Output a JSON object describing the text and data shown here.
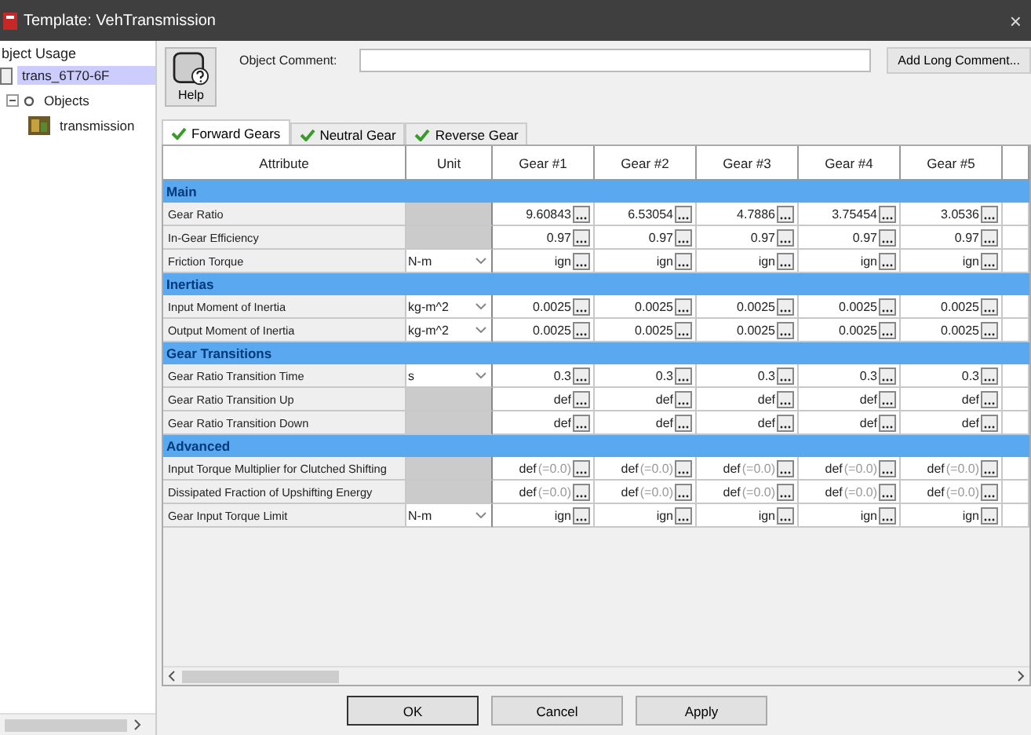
{
  "window": {
    "title": "Template: VehTransmission",
    "close": "×"
  },
  "sidebar": {
    "heading": "bject Usage",
    "items": [
      {
        "label": "trans_6T70-6F",
        "selected": true
      },
      {
        "label": "Objects",
        "selected": false,
        "expanded": true,
        "children": [
          {
            "label": "transmission",
            "selected": false
          }
        ]
      }
    ]
  },
  "help_button": "Help",
  "comment": {
    "label": "Object Comment:",
    "button": "Add Long Comment..."
  },
  "tabs": [
    {
      "label": "Forward Gears",
      "selected": true
    },
    {
      "label": "Neutral Gear",
      "selected": false
    },
    {
      "label": "Reverse Gear",
      "selected": false
    }
  ],
  "table": {
    "columns": [
      "Attribute",
      "Unit",
      "Gear #1",
      "Gear #2",
      "Gear #3",
      "Gear #4",
      "Gear #5"
    ],
    "rows": [
      {
        "kind": "group",
        "label": "Main"
      },
      {
        "kind": "data",
        "attribute": "Gear Ratio",
        "cells": [
          {
            "value": "9.60843"
          },
          {
            "value": "6.53054"
          },
          {
            "value": "4.7886"
          },
          {
            "value": "3.75454"
          },
          {
            "value": "3.0536"
          }
        ]
      },
      {
        "kind": "data",
        "attribute": "In-Gear Efficiency",
        "cells": [
          {
            "value": "0.97"
          },
          {
            "value": "0.97"
          },
          {
            "value": "0.97"
          },
          {
            "value": "0.97"
          },
          {
            "value": "0.97"
          }
        ]
      },
      {
        "kind": "data",
        "attribute": "Friction Torque",
        "unit": "N-m",
        "cells": [
          {
            "value": "ign"
          },
          {
            "value": "ign"
          },
          {
            "value": "ign"
          },
          {
            "value": "ign"
          },
          {
            "value": "ign"
          }
        ]
      },
      {
        "kind": "group",
        "label": "Inertias"
      },
      {
        "kind": "data",
        "attribute": "Input Moment of Inertia",
        "unit": "kg-m^2",
        "cells": [
          {
            "value": "0.0025"
          },
          {
            "value": "0.0025"
          },
          {
            "value": "0.0025"
          },
          {
            "value": "0.0025"
          },
          {
            "value": "0.0025"
          }
        ]
      },
      {
        "kind": "data",
        "attribute": "Output Moment of Inertia",
        "unit": "kg-m^2",
        "cells": [
          {
            "value": "0.0025"
          },
          {
            "value": "0.0025"
          },
          {
            "value": "0.0025"
          },
          {
            "value": "0.0025"
          },
          {
            "value": "0.0025"
          }
        ]
      },
      {
        "kind": "group",
        "label": "Gear Transitions"
      },
      {
        "kind": "data",
        "attribute": "Gear Ratio Transition Time",
        "unit": "s",
        "cells": [
          {
            "value": "0.3"
          },
          {
            "value": "0.3"
          },
          {
            "value": "0.3"
          },
          {
            "value": "0.3"
          },
          {
            "value": "0.3"
          }
        ]
      },
      {
        "kind": "data",
        "attribute": "Gear Ratio Transition Up",
        "cells": [
          {
            "value": "def"
          },
          {
            "value": "def"
          },
          {
            "value": "def"
          },
          {
            "value": "def"
          },
          {
            "value": "def"
          }
        ]
      },
      {
        "kind": "data",
        "attribute": "Gear Ratio Transition Down",
        "cells": [
          {
            "value": "def"
          },
          {
            "value": "def"
          },
          {
            "value": "def"
          },
          {
            "value": "def"
          },
          {
            "value": "def"
          }
        ]
      },
      {
        "kind": "group",
        "label": "Advanced"
      },
      {
        "kind": "data",
        "attribute": "Input Torque Multiplier for Clutched Shifting",
        "cells": [
          {
            "value": "def",
            "hint": "(=0.0)"
          },
          {
            "value": "def",
            "hint": "(=0.0)"
          },
          {
            "value": "def",
            "hint": "(=0.0)"
          },
          {
            "value": "def",
            "hint": "(=0.0)"
          },
          {
            "value": "def",
            "hint": "(=0.0)"
          }
        ]
      },
      {
        "kind": "data",
        "attribute": "Dissipated Fraction of Upshifting Energy",
        "cells": [
          {
            "value": "def",
            "hint": "(=0.0)"
          },
          {
            "value": "def",
            "hint": "(=0.0)"
          },
          {
            "value": "def",
            "hint": "(=0.0)"
          },
          {
            "value": "def",
            "hint": "(=0.0)"
          },
          {
            "value": "def",
            "hint": "(=0.0)"
          }
        ]
      },
      {
        "kind": "data",
        "attribute": "Gear Input Torque Limit",
        "unit": "N-m",
        "cells": [
          {
            "value": "ign"
          },
          {
            "value": "ign"
          },
          {
            "value": "ign"
          },
          {
            "value": "ign"
          },
          {
            "value": "ign"
          }
        ]
      }
    ]
  },
  "buttons": [
    {
      "label": "OK",
      "default": true
    },
    {
      "label": "Cancel",
      "default": false
    },
    {
      "label": "Apply",
      "default": false
    }
  ]
}
